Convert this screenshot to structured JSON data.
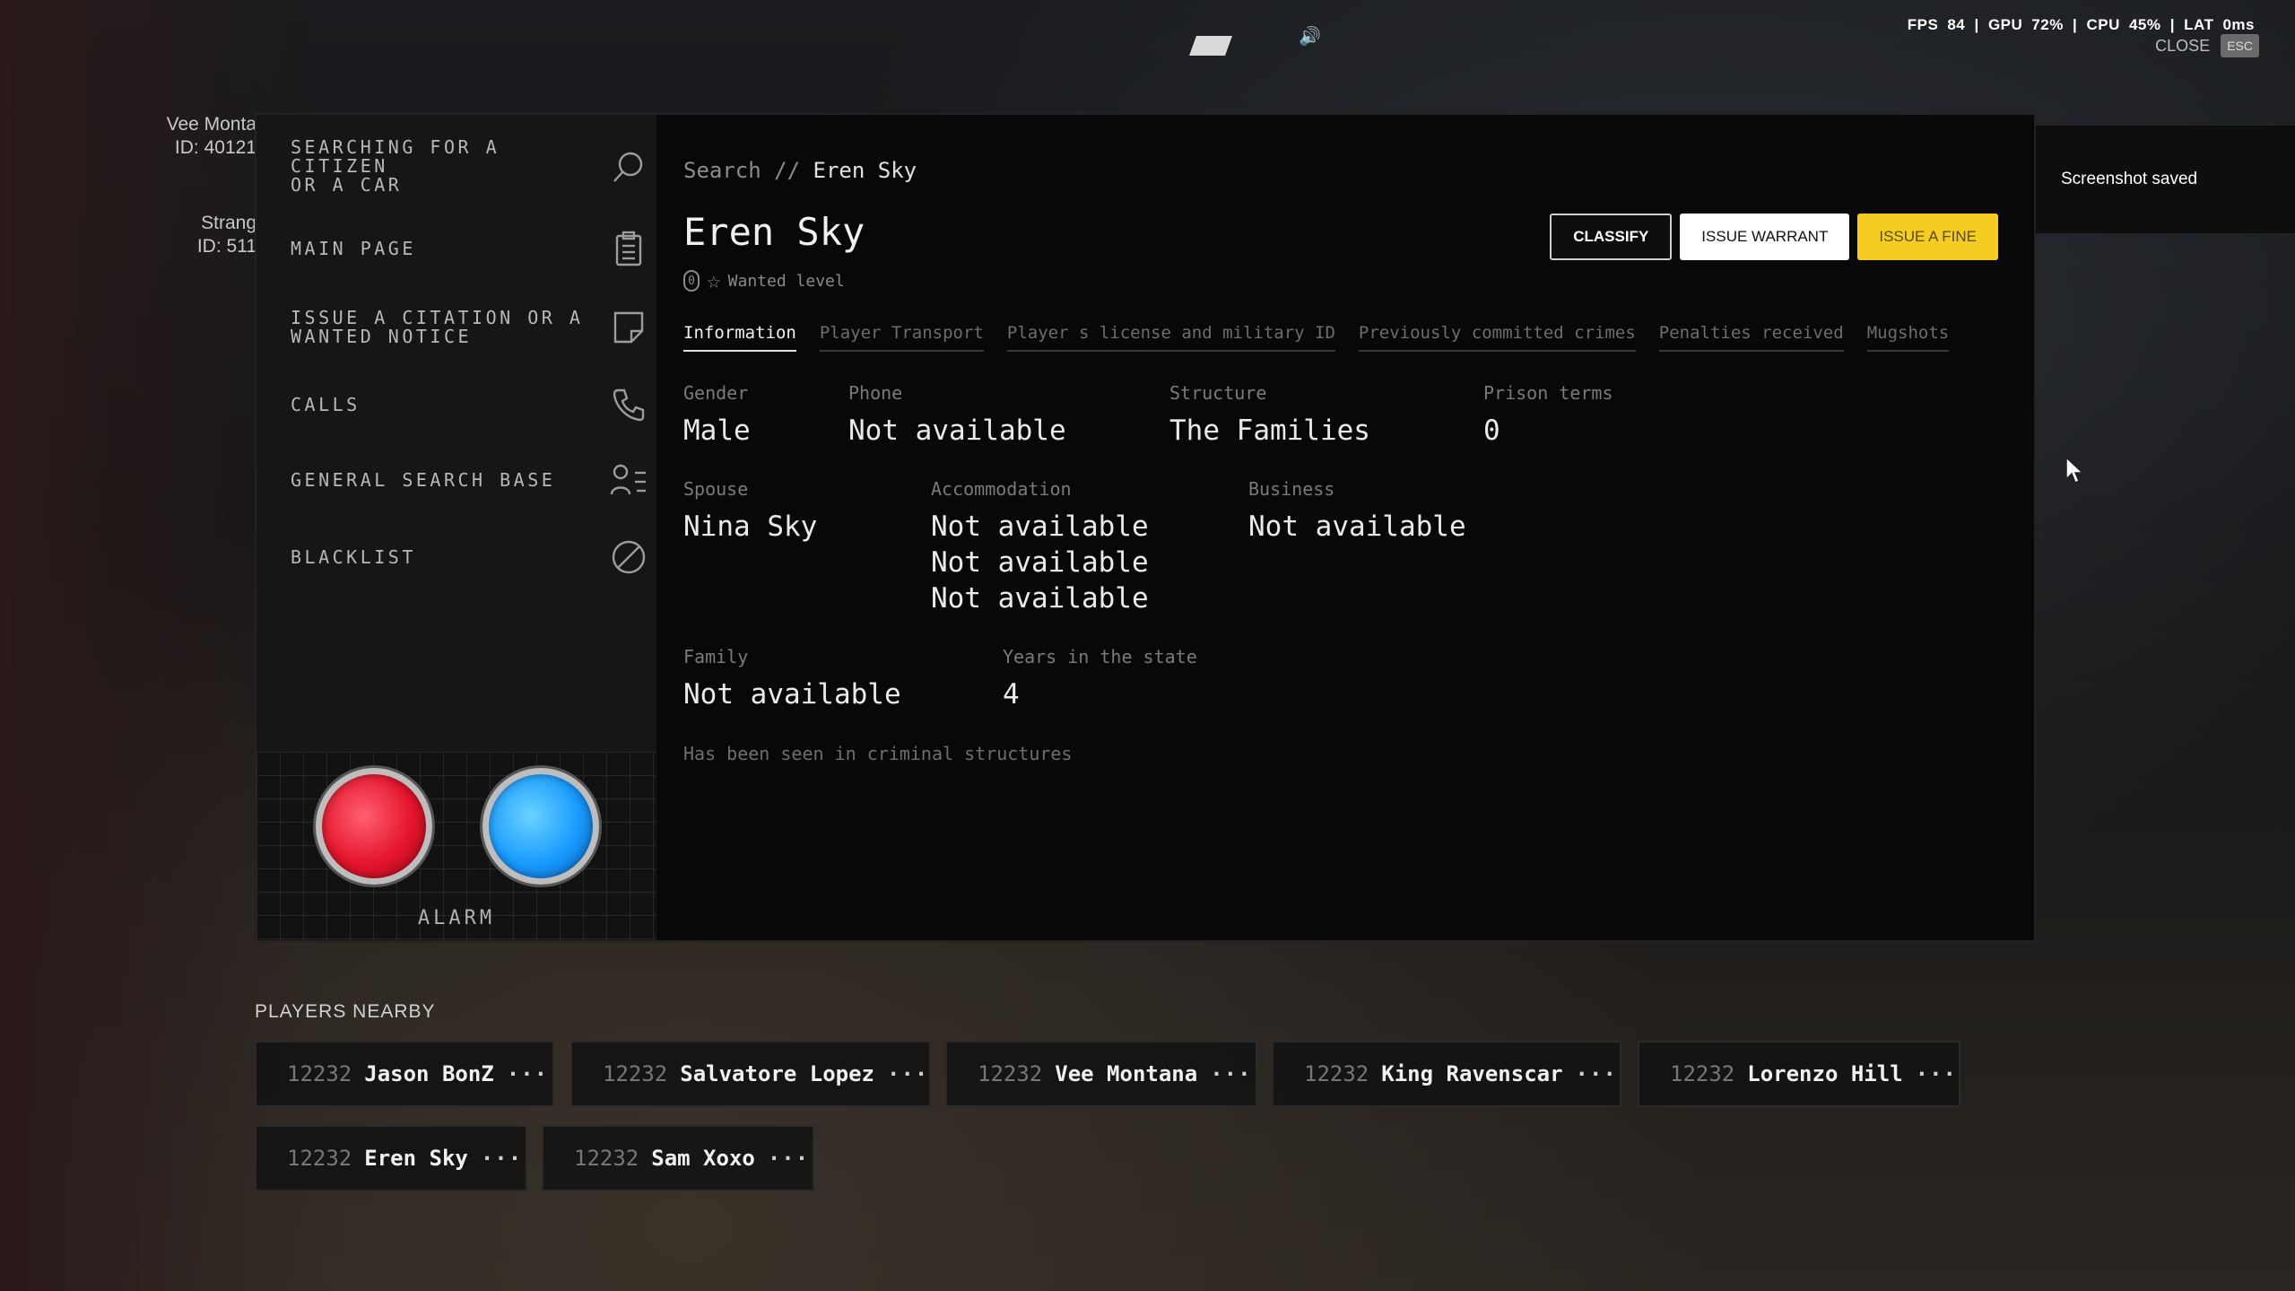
{
  "hud": {
    "fps_label": "FPS",
    "fps_value": "84",
    "gpu_label": "GPU",
    "gpu_value": "72%",
    "cpu_label": "CPU",
    "cpu_value": "45%",
    "lat_label": "LAT",
    "lat_value": "0ms",
    "close_label": "CLOSE",
    "esc_label": "ESC"
  },
  "background_tags": [
    {
      "name": "Vee Monta",
      "id": "ID: 40121"
    },
    {
      "name": "Strang",
      "id": "ID: 511"
    }
  ],
  "toast": {
    "text": "Screenshot saved"
  },
  "sidebar": {
    "items": [
      {
        "label": "SEARCHING FOR A\nCITIZEN\nOR A CAR",
        "icon": "search-icon"
      },
      {
        "label": "MAIN PAGE",
        "icon": "clipboard-icon"
      },
      {
        "label": "ISSUE A CITATION OR A\nWANTED NOTICE",
        "icon": "note-icon"
      },
      {
        "label": "CALLS",
        "icon": "phone-icon"
      },
      {
        "label": "GENERAL SEARCH BASE",
        "icon": "user-list-icon"
      },
      {
        "label": "BLACKLIST",
        "icon": "ban-icon"
      }
    ],
    "alarm_label": "ALARM"
  },
  "breadcrumb": {
    "root": "Search //",
    "current": "Eren Sky"
  },
  "person": {
    "name": "Eren Sky",
    "wanted_level": "0",
    "wanted_label": "Wanted level"
  },
  "actions": {
    "classify": "CLASSIFY",
    "warrant": "ISSUE WARRANT",
    "fine": "ISSUE A FINE"
  },
  "tabs": [
    "Information",
    "Player Transport",
    "Player s license and military ID",
    "Previously committed crimes",
    "Penalties received",
    "Mugshots"
  ],
  "info": {
    "gender": {
      "label": "Gender",
      "value": "Male"
    },
    "phone": {
      "label": "Phone",
      "value": "Not available"
    },
    "structure": {
      "label": "Structure",
      "value": "The Families"
    },
    "prison": {
      "label": "Prison terms",
      "value": "0"
    },
    "spouse": {
      "label": "Spouse",
      "value": "Nina Sky"
    },
    "accommodation": {
      "label": "Accommodation",
      "values": [
        "Not available",
        "Not available",
        "Not available"
      ]
    },
    "business": {
      "label": "Business",
      "value": "Not available"
    },
    "family": {
      "label": "Family",
      "value": "Not available"
    },
    "years": {
      "label": "Years in the state",
      "value": "4"
    },
    "note": "Has been seen in criminal structures"
  },
  "players_nearby": {
    "title": "PLAYERS NEARBY",
    "players": [
      {
        "id": "12232",
        "name": "Jason BonZ"
      },
      {
        "id": "12232",
        "name": "Salvatore Lopez"
      },
      {
        "id": "12232",
        "name": "Vee Montana"
      },
      {
        "id": "12232",
        "name": "King Ravenscar"
      },
      {
        "id": "12232",
        "name": "Lorenzo Hill"
      },
      {
        "id": "12232",
        "name": "Eren Sky"
      },
      {
        "id": "12232",
        "name": "Sam Xoxo"
      }
    ],
    "more_glyph": "···"
  },
  "colors": {
    "accent_yellow": "#f5cd20",
    "alarm_red": "#e5142c",
    "alarm_blue": "#189bff",
    "toast_bar": "#7bb52c"
  }
}
